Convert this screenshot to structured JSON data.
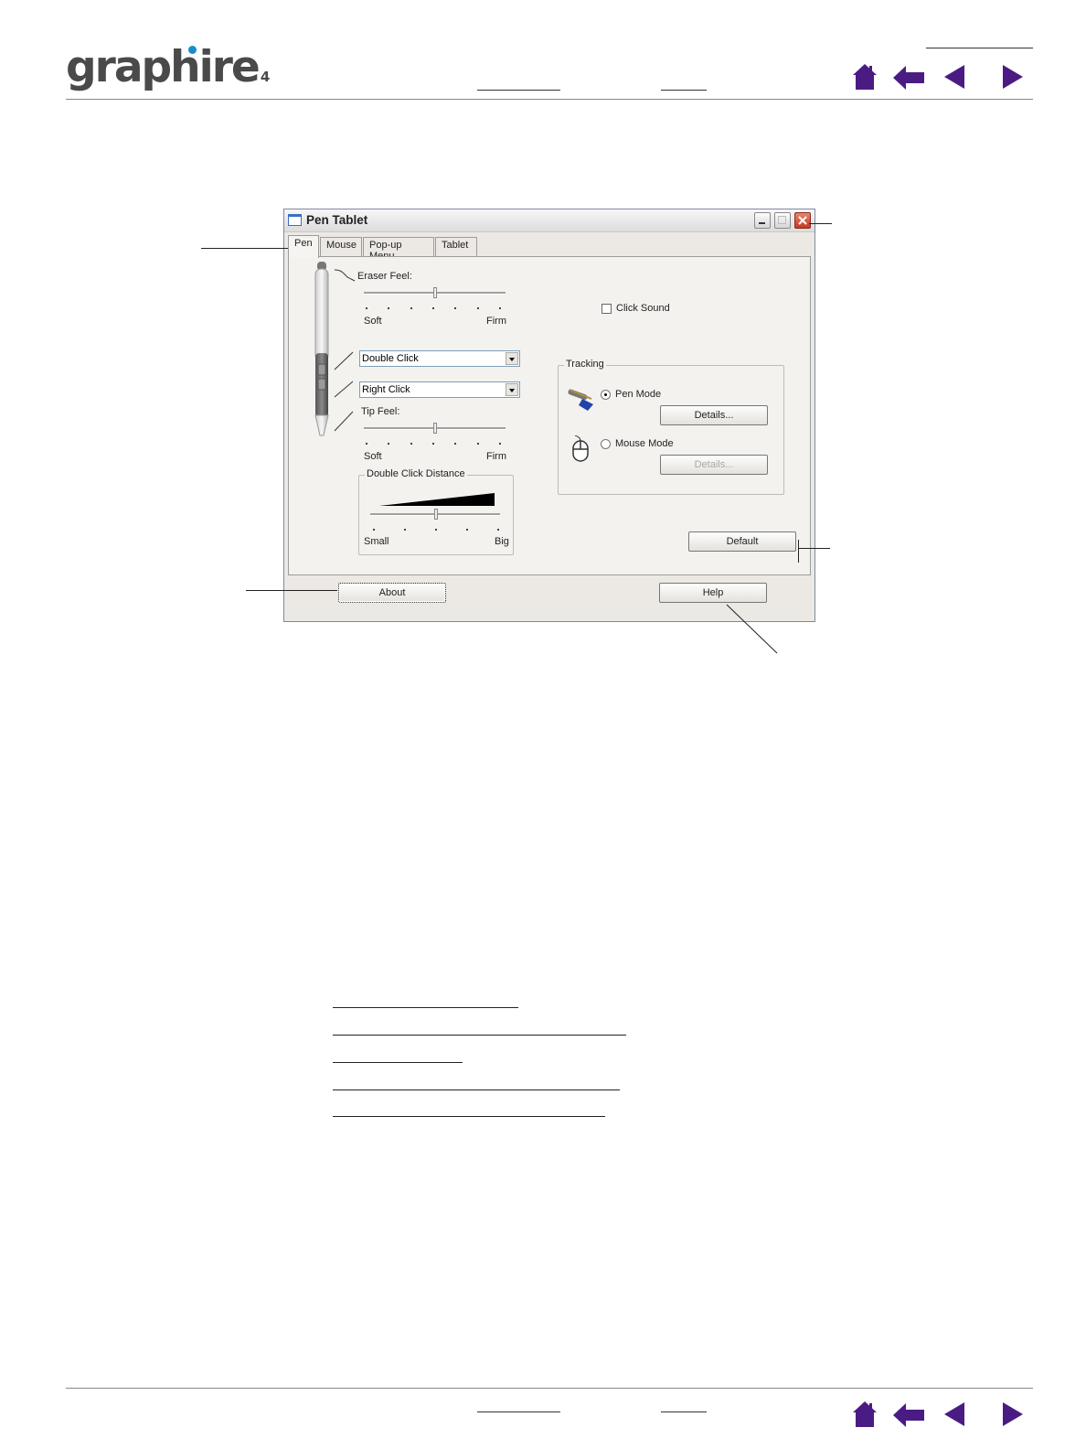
{
  "header": {
    "logo_text": "graphire",
    "logo_number": "4"
  },
  "nav_icons": [
    "home-icon",
    "back-arrow-icon",
    "previous-page-icon",
    "next-page-icon"
  ],
  "dialog": {
    "title": "Pen Tablet",
    "tabs": [
      {
        "label": "Pen",
        "active": true
      },
      {
        "label": "Mouse",
        "active": false
      },
      {
        "label": "Pop-up Menu",
        "active": false
      },
      {
        "label": "Tablet",
        "active": false
      }
    ],
    "eraser_feel": {
      "label": "Eraser Feel:",
      "min_label": "Soft",
      "max_label": "Firm",
      "level": 0.5
    },
    "upper_button": {
      "value": "Double Click"
    },
    "lower_button": {
      "value": "Right Click"
    },
    "tip_feel": {
      "label": "Tip Feel:",
      "min_label": "Soft",
      "max_label": "Firm",
      "level": 0.5
    },
    "double_click_distance": {
      "label": "Double Click Distance",
      "min_label": "Small",
      "max_label": "Big",
      "level": 0.5
    },
    "click_sound": {
      "label": "Click Sound",
      "checked": false
    },
    "tracking": {
      "label": "Tracking",
      "pen_mode": {
        "label": "Pen Mode",
        "selected": true,
        "details_label": "Details..."
      },
      "mouse_mode": {
        "label": "Mouse Mode",
        "selected": false,
        "details_label": "Details..."
      }
    },
    "default_label": "Default",
    "about_label": "About",
    "help_label": "Help"
  },
  "colors": {
    "nav_icon": "#4b1b84",
    "logo_dot": "#1a8ccc",
    "logo_text": "#4a4a4a",
    "close_button": "#c33b22"
  }
}
